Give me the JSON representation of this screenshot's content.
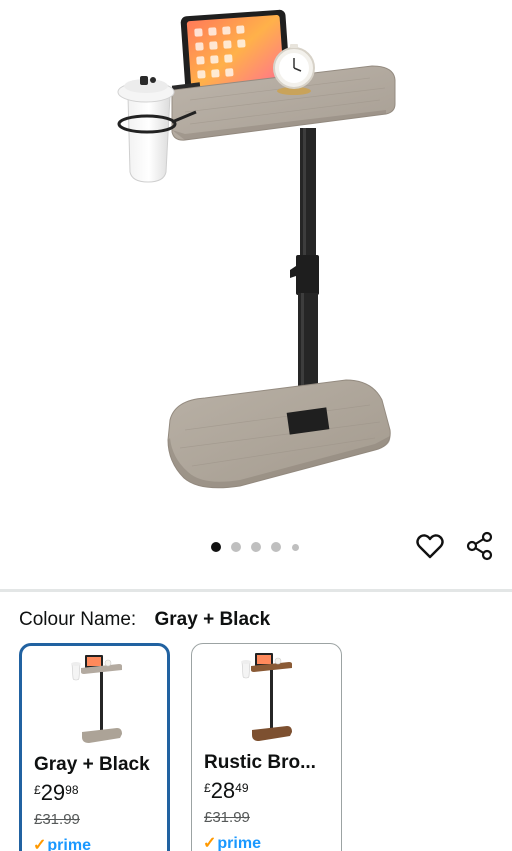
{
  "carousel": {
    "dot_count": 5,
    "active_index": 0
  },
  "product_image": {
    "icon": "side-table-product-image"
  },
  "actions": {
    "wishlist_icon": "heart-icon",
    "share_icon": "share-icon"
  },
  "variation": {
    "label": "Colour Name:",
    "selected_value": "Gray + Black"
  },
  "swatches": [
    {
      "name": "Gray + Black",
      "currency": "£",
      "price_whole": "29",
      "price_fraction": "98",
      "was_price": "£31.99",
      "prime": "prime",
      "selected": true,
      "top_color": "#b3aaa0",
      "base_color": "#aca397"
    },
    {
      "name": "Rustic Bro...",
      "currency": "£",
      "price_whole": "28",
      "price_fraction": "49",
      "was_price": "£31.99",
      "prime": "prime",
      "selected": false,
      "top_color": "#8a5a35",
      "base_color": "#7d5030"
    }
  ],
  "colors": {
    "selected_border": "#2162a1",
    "prime_blue": "#1a98ff",
    "prime_check": "#ff9900"
  }
}
